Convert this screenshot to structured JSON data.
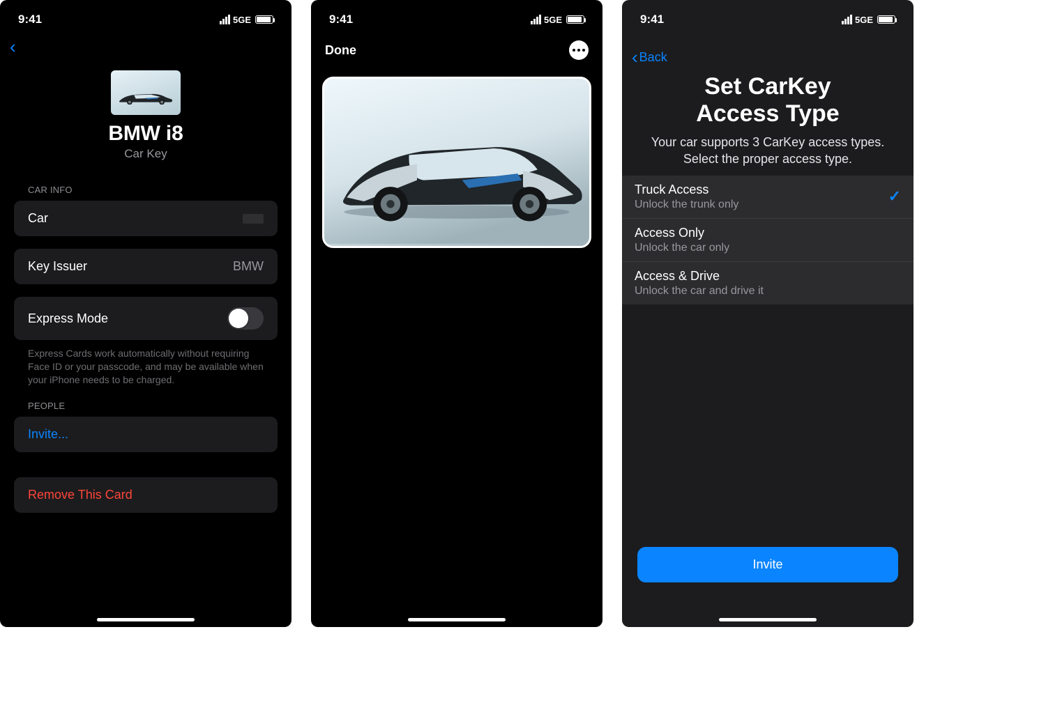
{
  "status": {
    "time": "9:41",
    "network": "5GE"
  },
  "screen1": {
    "title": "BMW i8",
    "subtitle": "Car Key",
    "section_carinfo": "CAR INFO",
    "row_car_label": "Car",
    "row_issuer_label": "Key Issuer",
    "row_issuer_value": "BMW",
    "row_express_label": "Express Mode",
    "express_footer": "Express Cards work automatically without requiring Face ID or your passcode, and may be available when your iPhone needs to be charged.",
    "section_people": "PEOPLE",
    "invite_label": "Invite...",
    "remove_label": "Remove This Card"
  },
  "screen2": {
    "done": "Done"
  },
  "screen3": {
    "back": "Back",
    "title_line1": "Set CarKey",
    "title_line2": "Access Type",
    "subtitle": "Your car supports 3 CarKey access types. Select the proper access type.",
    "options": [
      {
        "title": "Truck Access",
        "desc": "Unlock the trunk only",
        "selected": true
      },
      {
        "title": "Access Only",
        "desc": "Unlock the car only",
        "selected": false
      },
      {
        "title": "Access & Drive",
        "desc": "Unlock the car and drive it",
        "selected": false
      }
    ],
    "invite_button": "Invite"
  }
}
